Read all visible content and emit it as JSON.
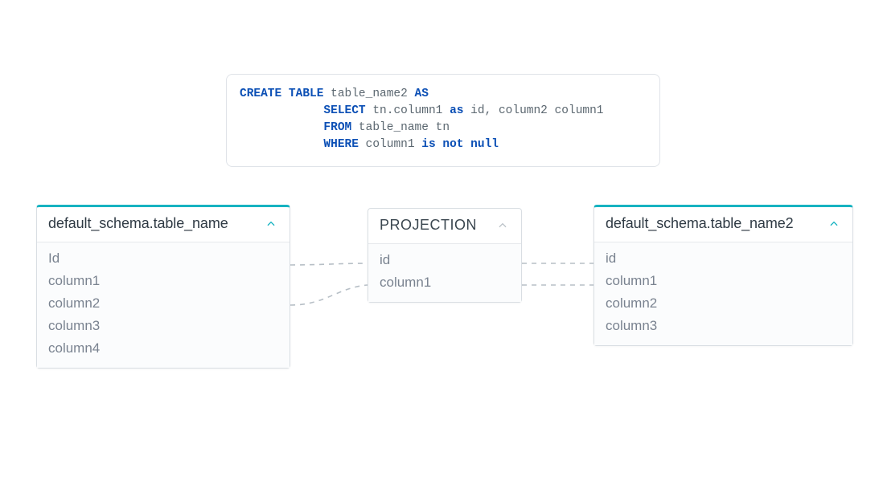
{
  "sql": {
    "l1": {
      "kw1": "CREATE TABLE",
      "name": " table_name2 ",
      "kw2": "AS"
    },
    "l2": {
      "indent": "            ",
      "kw": "SELECT",
      "txt1": " tn.column1 ",
      "kw2": "as",
      "txt2": " id, column2 column1"
    },
    "l3": {
      "indent": "            ",
      "kw": "FROM",
      "txt": " table_name tn"
    },
    "l4": {
      "indent": "            ",
      "kw": "WHERE",
      "txt1": " column1 ",
      "kw2": "is not null"
    }
  },
  "nodes": {
    "left": {
      "title": "default_schema.table_name",
      "columns": [
        "Id",
        "column1",
        "column2",
        "column3",
        "column4"
      ]
    },
    "mid": {
      "title": "PROJECTION",
      "columns": [
        "id",
        "column1"
      ]
    },
    "right": {
      "title": "default_schema.table_name2",
      "columns": [
        "id",
        "column1",
        "column2",
        "column3"
      ]
    }
  }
}
